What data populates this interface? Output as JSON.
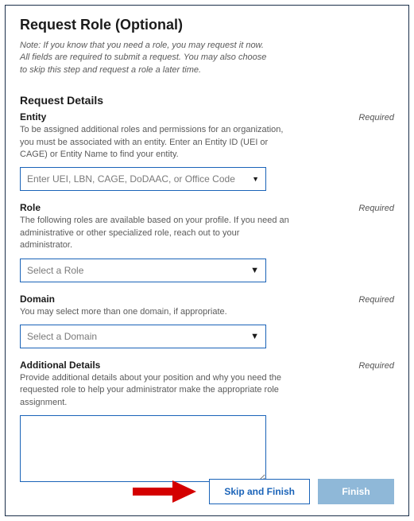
{
  "title": "Request Role (Optional)",
  "note": "Note: If you know that you need a role, you may request it now. All fields are required to submit a request. You may also choose to skip this step and request a role a later time.",
  "sectionHead": "Request Details",
  "requiredLabel": "Required",
  "entity": {
    "label": "Entity",
    "help": "To be assigned additional roles and permissions for an organization, you must be associated with an entity. Enter an Entity ID (UEI or CAGE) or Entity Name to find your entity.",
    "placeholder": "Enter UEI, LBN, CAGE, DoDAAC, or Office Code"
  },
  "role": {
    "label": "Role",
    "help": "The following roles are available based on your profile. If you need an administrative or other specialized role, reach out to your administrator.",
    "placeholder": "Select a Role"
  },
  "domain": {
    "label": "Domain",
    "help": "You may select more than one domain, if appropriate.",
    "placeholder": "Select a Domain"
  },
  "details": {
    "label": "Additional Details",
    "help": "Provide additional details about your position and why you need the requested role to help your administrator make the appropriate role assignment."
  },
  "buttons": {
    "skip": "Skip and Finish",
    "finish": "Finish"
  }
}
